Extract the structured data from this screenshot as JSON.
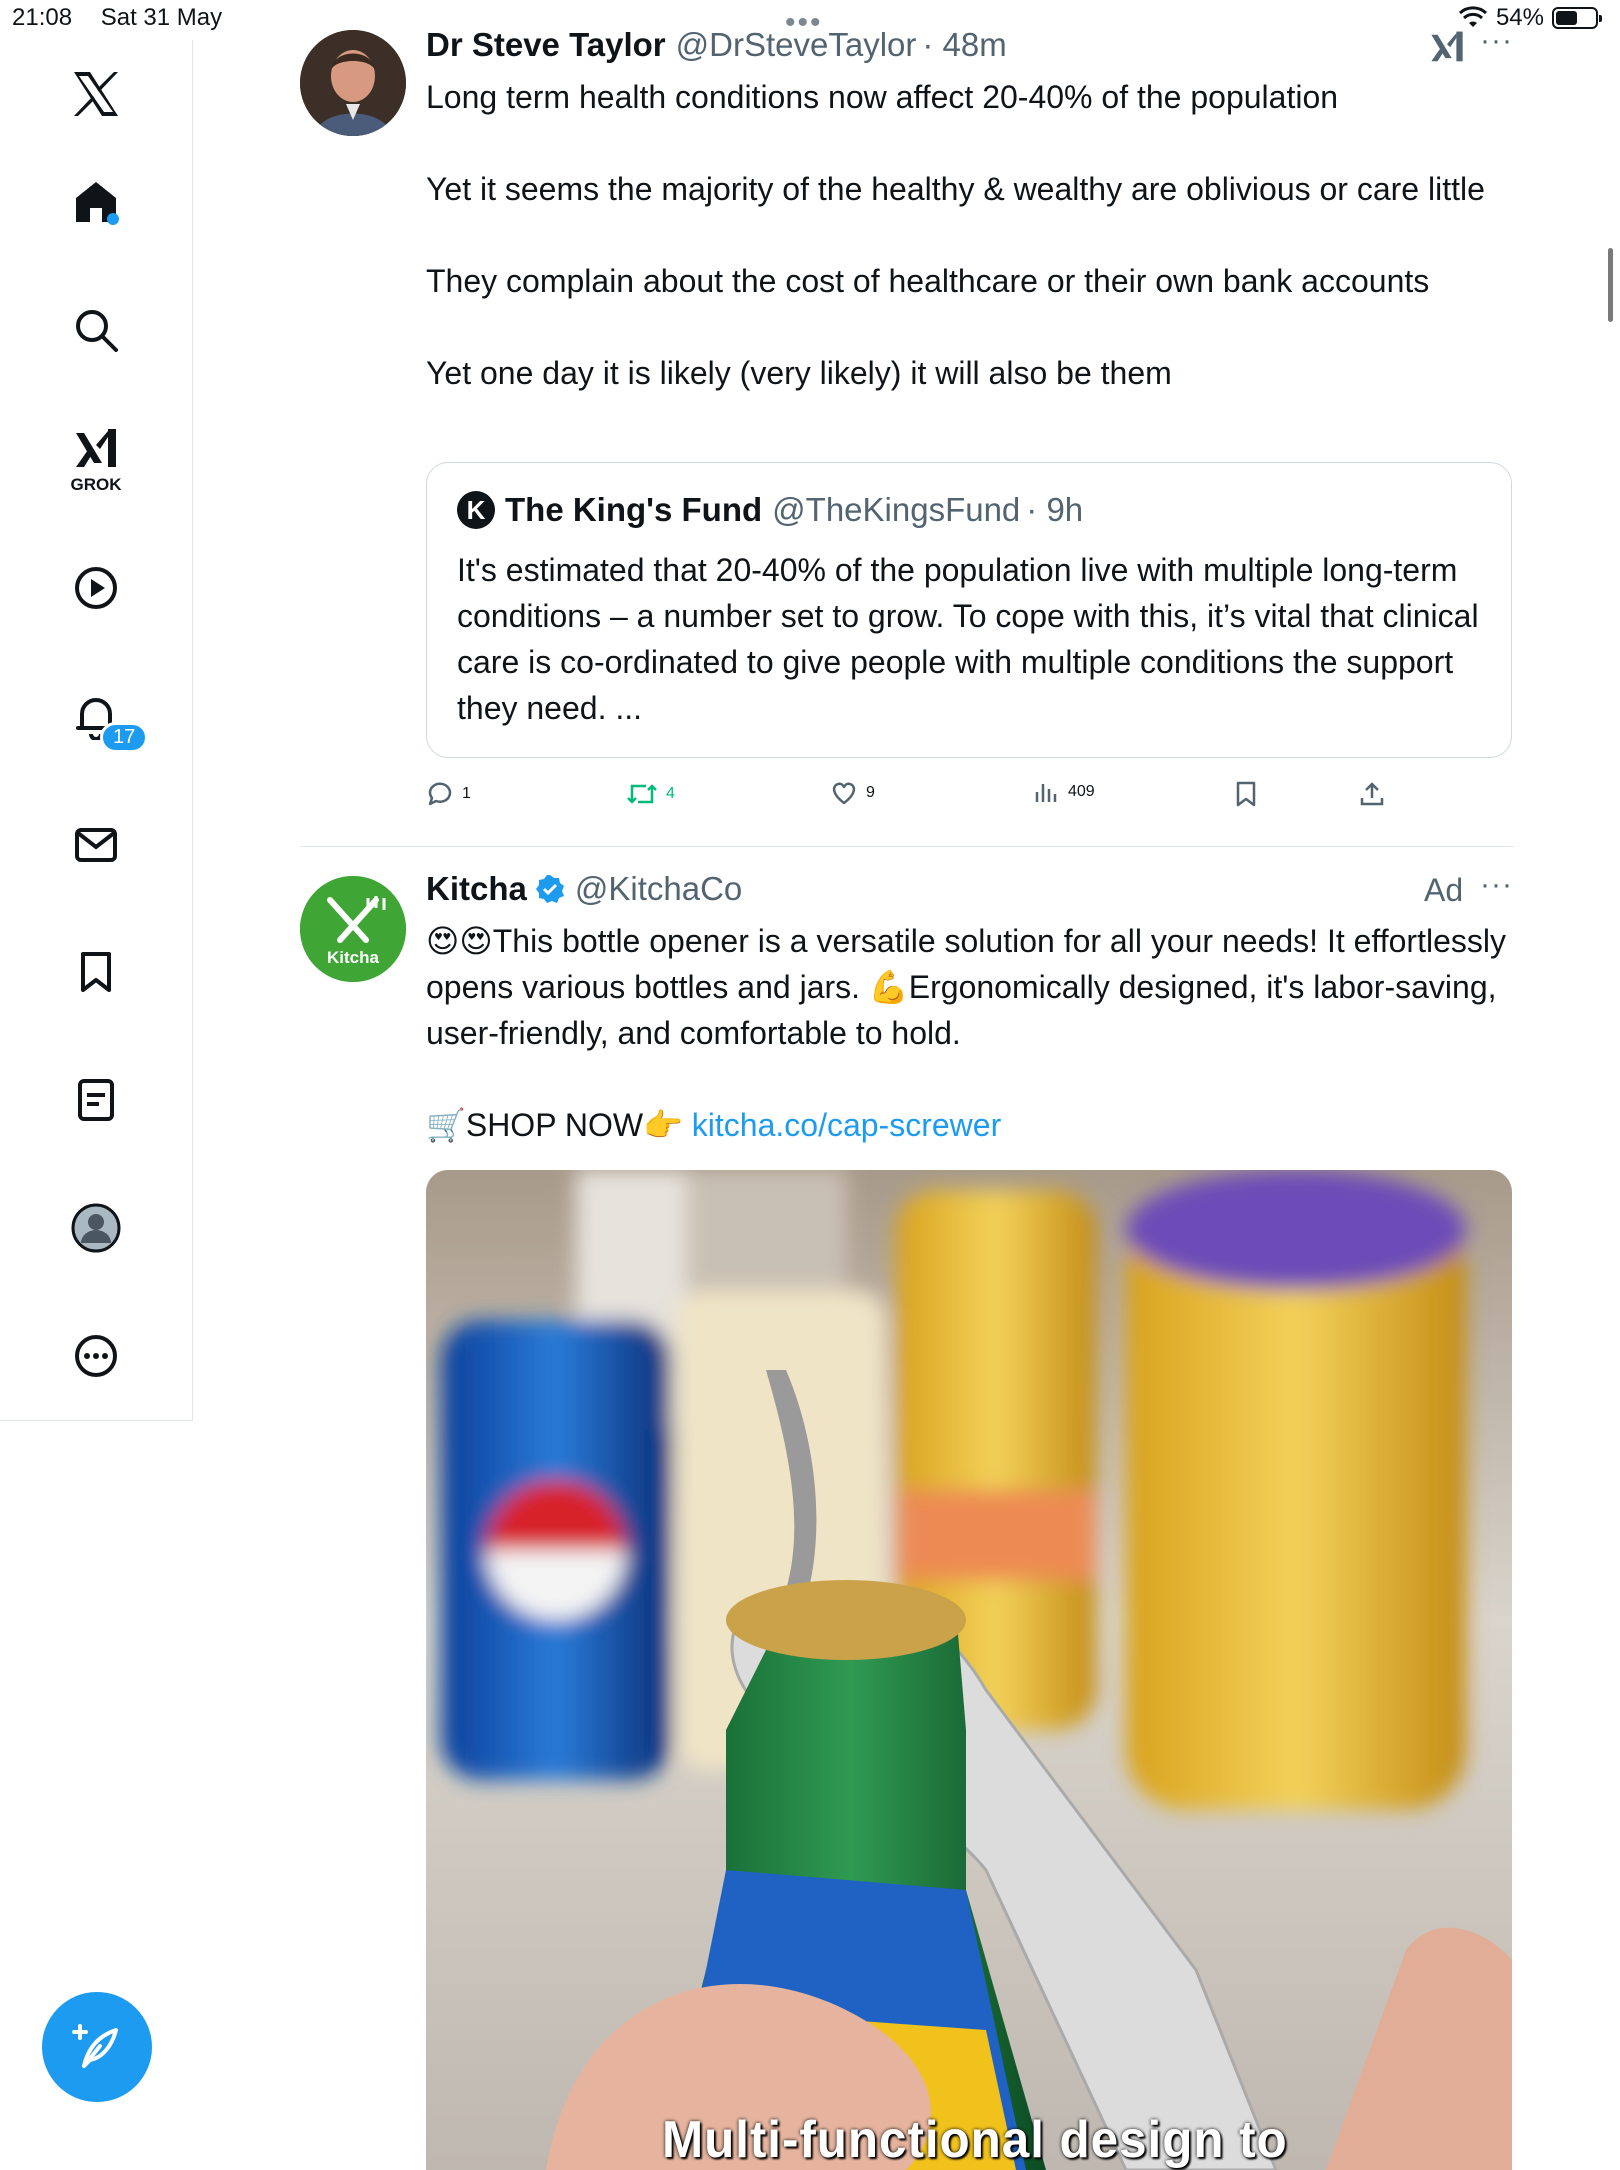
{
  "status_bar": {
    "time": "21:08",
    "date": "Sat 31 May",
    "battery": "54%",
    "battery_level": 0.54
  },
  "sidebar": {
    "items": [
      {
        "name": "x-logo-icon"
      },
      {
        "name": "home-icon"
      },
      {
        "name": "search-icon"
      },
      {
        "name": "grok-icon",
        "label": "GROK"
      },
      {
        "name": "video-icon"
      },
      {
        "name": "notifications-icon",
        "badge": "17"
      },
      {
        "name": "messages-icon"
      },
      {
        "name": "bookmarks-icon"
      },
      {
        "name": "lists-icon"
      },
      {
        "name": "profile-icon"
      },
      {
        "name": "more-icon"
      }
    ],
    "compose": {
      "name": "compose-post-icon"
    }
  },
  "tweet1": {
    "name": "Dr Steve Taylor",
    "handle": "@DrSteveTaylor",
    "time": "· 48m",
    "paragraphs": [
      "Long term health conditions now affect 20-40% of the population",
      "Yet it seems the majority of the healthy & wealthy are oblivious or care little",
      "They complain about the cost of healthcare or their own bank accounts",
      "Yet one day it is likely (very likely) it will also be them"
    ],
    "quote": {
      "avatar_letter": "K",
      "name": "The King's Fund",
      "handle": "@TheKingsFund",
      "time": "· 9h",
      "text": "It's estimated that 20-40% of the population live with multiple long-term conditions – a number set to grow. To cope with this, it’s vital that clinical care is co-ordinated to give people with multiple conditions the support they need. ..."
    },
    "actions": {
      "replies": "1",
      "reposts": "4",
      "likes": "9",
      "views": "409"
    }
  },
  "tweet2": {
    "name": "Kitcha",
    "handle": "@KitchaCo",
    "ad_label": "Ad",
    "avatar_text": "Kitcha",
    "text_line": "😍😍This bottle opener is a versatile solution for all your needs! It effortlessly opens various bottles and jars. 💪Ergonomically designed, it's labor-saving, user-friendly, and comfortable to hold.",
    "shop_text": "🛒SHOP NOW👉",
    "link_text": "kitcha.co/cap-screwer",
    "media_caption": "Multi-functional design to"
  },
  "colors": {
    "accent": "#1d9bf0",
    "repost_active": "#00ba7c",
    "kitcha_green": "#3fa535"
  }
}
